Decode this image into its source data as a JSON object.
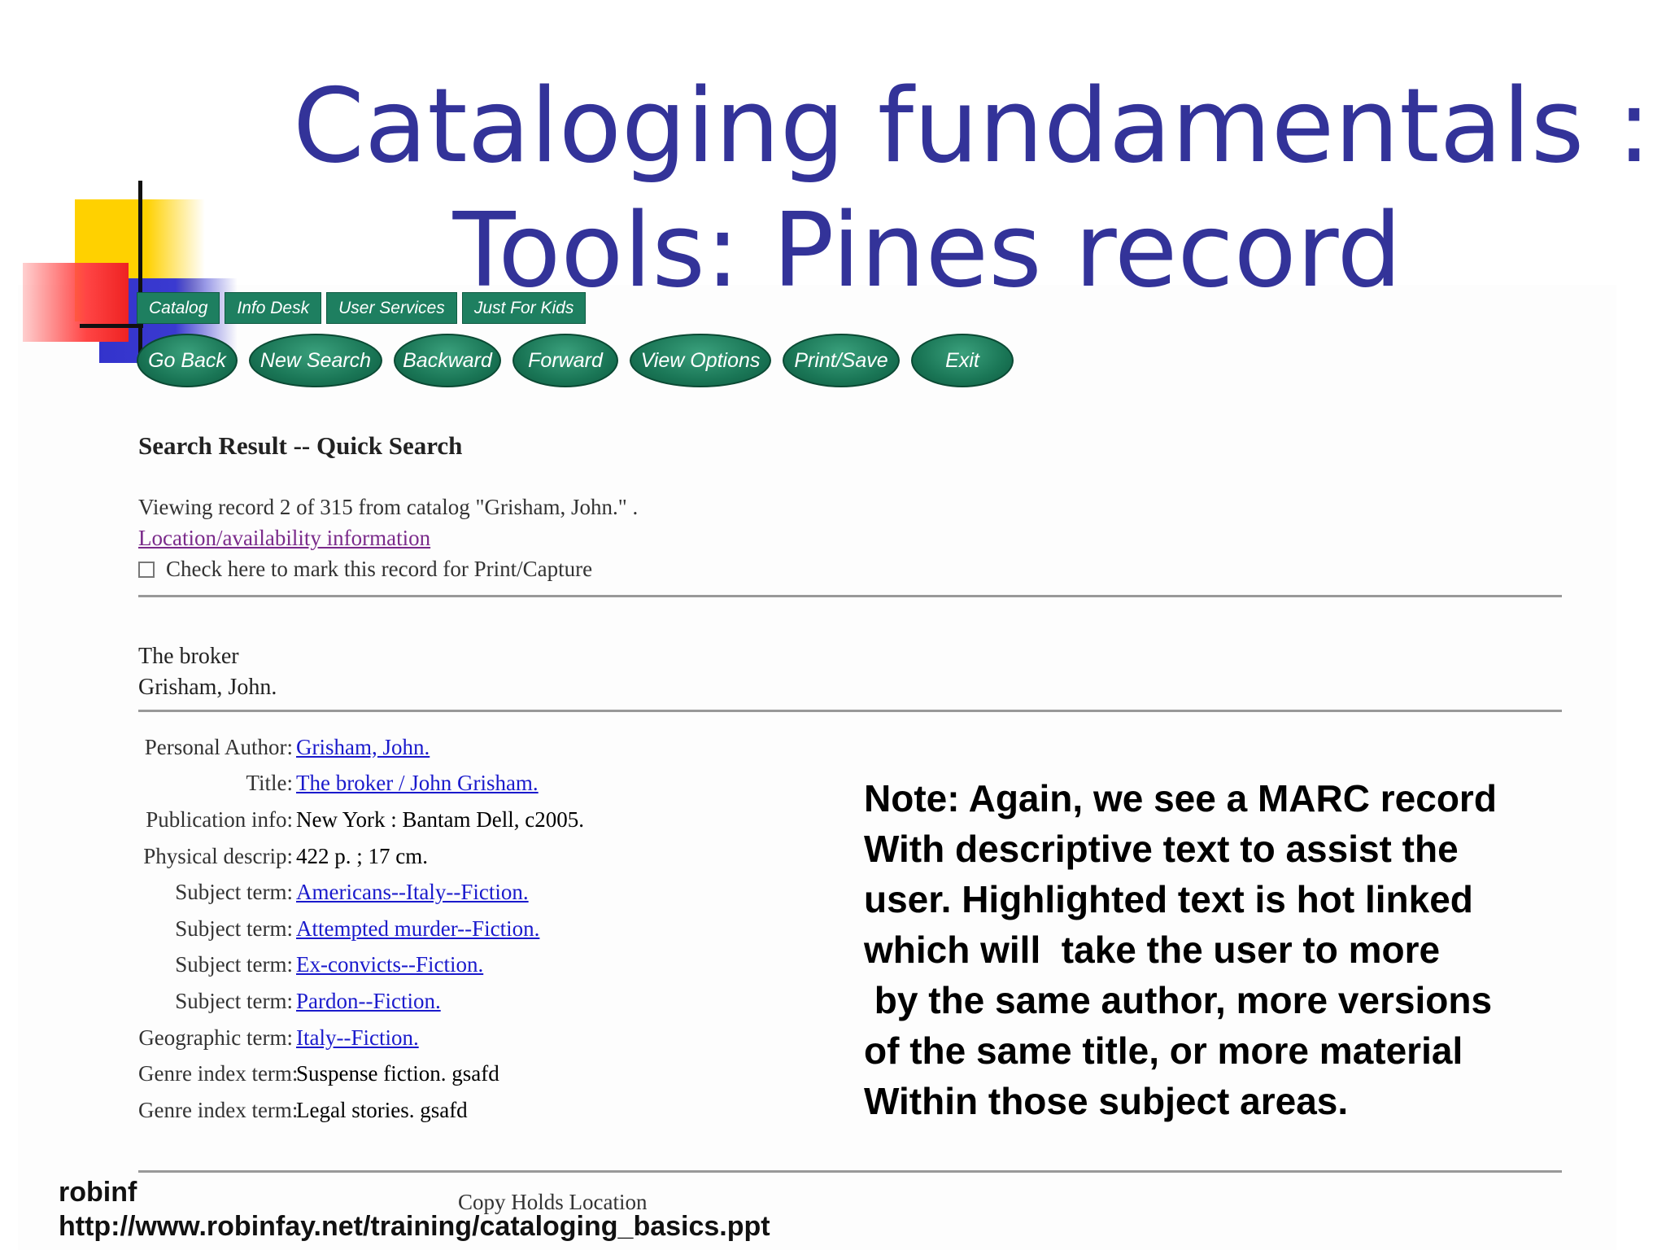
{
  "slide": {
    "title_line1": "Cataloging fundamentals :",
    "title_line2": "Tools: Pines record",
    "footer_author": "robinf",
    "footer_url": "http://www.robinfay.net/training/cataloging_basics.ppt",
    "note_lines": [
      "Note: Again, we see a MARC record",
      "With descriptive text to assist the",
      "user. Highlighted text is hot linked",
      "which will  take the user to more",
      " by the same author, more versions",
      "of the same title, or more material",
      "Within those subject areas."
    ]
  },
  "catalog": {
    "tabs": [
      "Catalog",
      "Info Desk",
      "User Services",
      "Just For Kids"
    ],
    "nav_buttons": [
      "Go Back",
      "New Search",
      "Backward",
      "Forward",
      "View Options",
      "Print/Save",
      "Exit"
    ],
    "search_heading": "Search Result -- Quick Search",
    "viewing_text": "Viewing record 2 of 315 from catalog \"Grisham, John.\" .",
    "availability_link": "Location/availability information",
    "mark_checkbox_label": "Check here to mark this record for Print/Capture",
    "record_title": "The broker",
    "record_author": "Grisham, John.",
    "fields": [
      {
        "label": "Personal Author:",
        "value": "Grisham, John.",
        "link": true
      },
      {
        "label": "Title:",
        "value": "The broker / John Grisham.",
        "link": true
      },
      {
        "label": "Publication info:",
        "value": "New York : Bantam Dell, c2005.",
        "link": false
      },
      {
        "label": "Physical descrip:",
        "value": "422 p. ; 17 cm.",
        "link": false
      },
      {
        "label": "Subject term:",
        "value": "Americans--Italy--Fiction.",
        "link": true
      },
      {
        "label": "Subject term:",
        "value": "Attempted murder--Fiction.",
        "link": true
      },
      {
        "label": "Subject term:",
        "value": "Ex-convicts--Fiction.",
        "link": true
      },
      {
        "label": "Subject term:",
        "value": "Pardon--Fiction.",
        "link": true
      },
      {
        "label": "Geographic term:",
        "value": "Italy--Fiction.",
        "link": true
      },
      {
        "label": "Genre index term:",
        "value": "Suspense fiction. gsafd",
        "link": false
      },
      {
        "label": "Genre index term:",
        "value": "Legal stories. gsafd",
        "link": false
      }
    ],
    "copy_header": "Copy   Holds Location"
  }
}
